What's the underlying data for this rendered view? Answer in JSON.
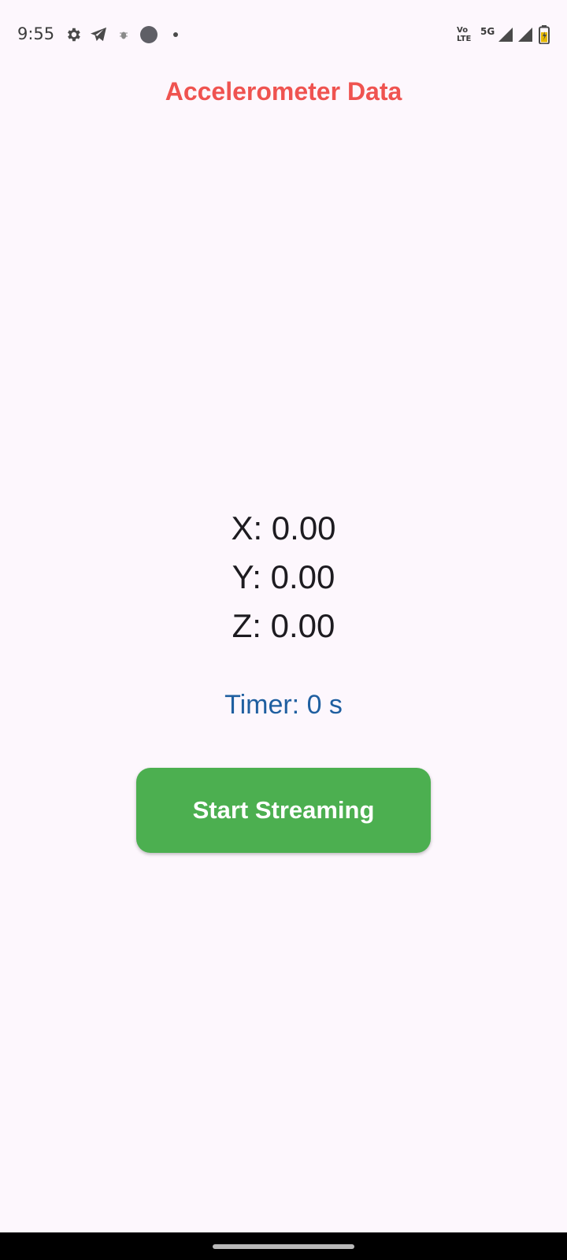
{
  "status_bar": {
    "time": "9:55",
    "net_top": "Vo",
    "net_bottom": "LTE",
    "network_type": "5G",
    "icons": [
      "gear-icon",
      "telegram-icon",
      "bug-icon",
      "circle-icon",
      "dot-icon",
      "volte-icon",
      "signal-icon",
      "signal-icon",
      "battery-icon"
    ]
  },
  "app": {
    "title": "Accelerometer Data"
  },
  "readings": {
    "x": "X: 0.00",
    "y": "Y: 0.00",
    "z": "Z: 0.00"
  },
  "timer": {
    "text": "Timer: 0 s"
  },
  "actions": {
    "start_label": "Start Streaming"
  },
  "colors": {
    "title": "#ef5350",
    "timer": "#1f5fa0",
    "button": "#4caf50",
    "background": "#fdf7fd"
  }
}
